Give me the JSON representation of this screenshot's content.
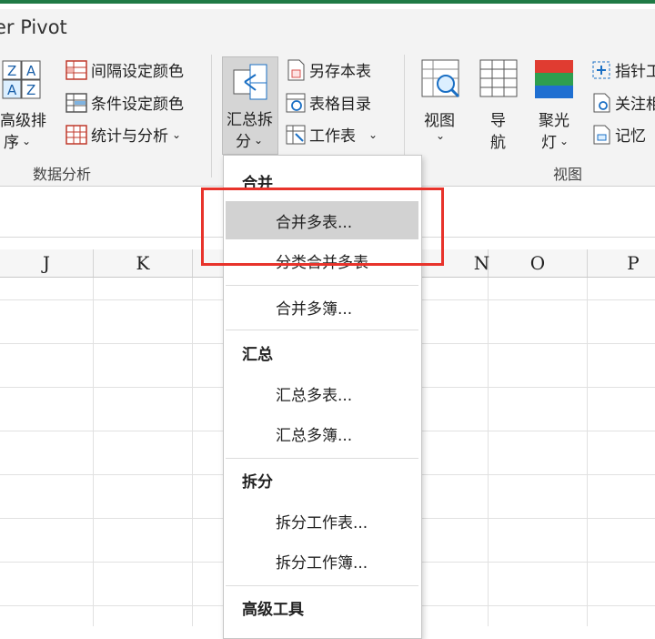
{
  "ribbon_tab": {
    "label": "er Pivot"
  },
  "data_analysis": {
    "sort_label_1": "高级排",
    "sort_label_2": "序",
    "items": [
      "间隔设定颜色",
      "条件设定颜色",
      "统计与分析"
    ],
    "group_label": "数据分析"
  },
  "summary_split": {
    "label_1": "汇总拆",
    "label_2": "分"
  },
  "sheet_tools": {
    "items": [
      "另存本表",
      "表格目录",
      "工作表"
    ]
  },
  "view_group": {
    "view_label": "视图",
    "nav_label_1": "导",
    "nav_label_2": "航",
    "spotlight_label_1": "聚光",
    "spotlight_label_2": "灯",
    "right_items": [
      "指针工",
      "关注相",
      "记忆"
    ],
    "group_label": "视图"
  },
  "columns": [
    "J",
    "K",
    "N",
    "O",
    "P"
  ],
  "dropdown": {
    "sections": [
      {
        "title": "合并",
        "items": [
          "合并多表...",
          "分类合并多表",
          "合并多簿..."
        ]
      },
      {
        "title": "汇总",
        "items": [
          "汇总多表...",
          "汇总多簿..."
        ]
      },
      {
        "title": "拆分",
        "items": [
          "拆分工作表...",
          "拆分工作簿..."
        ]
      },
      {
        "title": "高级工具",
        "items": []
      }
    ],
    "highlighted": "合并多表..."
  },
  "colors": {
    "accent_green": "#1f7a45",
    "highlight_red": "#e8332b"
  }
}
